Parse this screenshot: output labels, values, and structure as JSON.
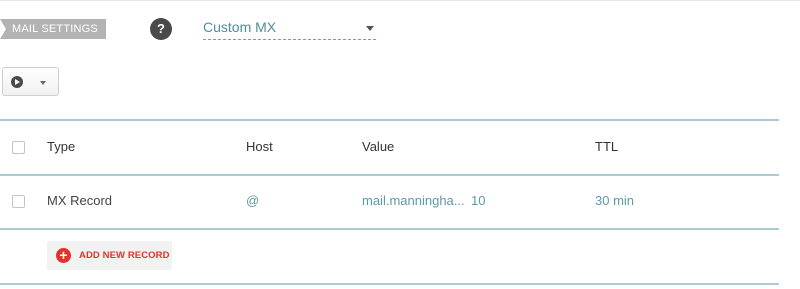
{
  "mail_settings": {
    "tag_label": "MAIL SETTINGS",
    "help_icon": "question-icon",
    "help_symbol": "?",
    "selected_option": "Custom MX"
  },
  "toolbar": {
    "action_icon": "play-circle-icon",
    "dropdown_icon": "caret-down-icon"
  },
  "table": {
    "headers": [
      "Type",
      "Host",
      "Value",
      "TTL"
    ],
    "rows": [
      {
        "type": "MX Record",
        "host": "@",
        "value": "mail.manningha...",
        "priority": "10",
        "ttl": "30 min"
      }
    ]
  },
  "add_record": {
    "icon": "plus-circle-icon",
    "symbol": "+",
    "label": "ADD NEW RECORD"
  },
  "colors": {
    "accent_teal": "#4f8f9b",
    "rule_blue": "#a8cdd4",
    "danger_red": "#e0332b",
    "tag_gray": "#b3b3b3"
  }
}
